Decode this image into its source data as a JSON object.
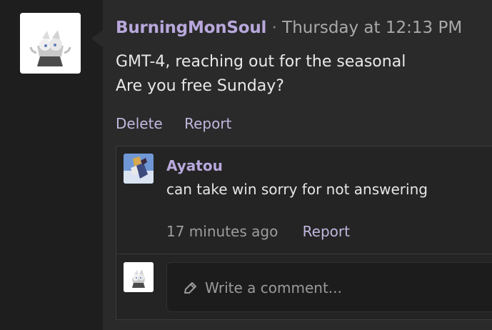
{
  "post": {
    "username": "BurningMonSoul",
    "separator": "·",
    "timestamp": "Thursday at 12:13 PM",
    "lines": [
      "GMT-4, reaching out for the seasonal",
      "Are you free Sunday?"
    ],
    "actions": {
      "delete": "Delete",
      "report": "Report"
    },
    "avatar_icon": "white-creature-avatar"
  },
  "comments": [
    {
      "author": "Ayatou",
      "text": "can take win sorry for not answering",
      "time": "17 minutes ago",
      "report": "Report",
      "avatar_icon": "anime-character-avatar"
    }
  ],
  "composer": {
    "placeholder": "Write a comment...",
    "icon": "pencil-icon",
    "avatar_icon": "white-creature-avatar"
  },
  "colors": {
    "background": "#1e1e1e",
    "panel": "#2a2a2a",
    "accent": "#b8a8dc",
    "action_link": "#c2b7de",
    "text": "#e8e8e8",
    "muted": "#9d9d9d"
  }
}
